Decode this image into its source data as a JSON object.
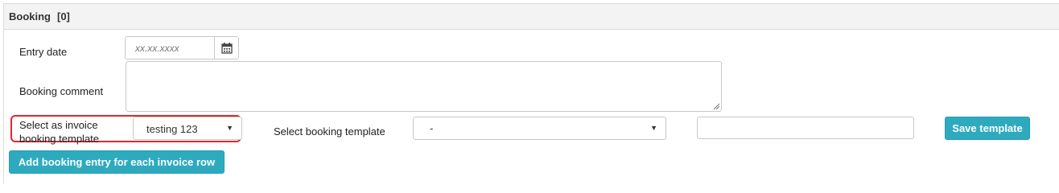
{
  "panel": {
    "title": "Booking",
    "count": "[0]"
  },
  "fields": {
    "entry_date_label": "Entry date",
    "entry_date_placeholder": "xx.xx.xxxx",
    "booking_comment_label": "Booking comment",
    "invoice_template_label_line1": "Select as invoice",
    "invoice_template_label_line2": "booking template",
    "invoice_template_value": "testing 123",
    "booking_template_label": "Select booking template",
    "booking_template_value": "-",
    "template_name_value": ""
  },
  "buttons": {
    "save_template": "Save template",
    "add_entry": "Add booking entry for each invoice row"
  },
  "colors": {
    "button_bg": "#2eaabf",
    "highlight_border": "#e3262f",
    "header_bg": "#f3f3f3"
  },
  "icons": {
    "calendar": "calendar-icon",
    "dropdown": "chevron-down-icon"
  }
}
